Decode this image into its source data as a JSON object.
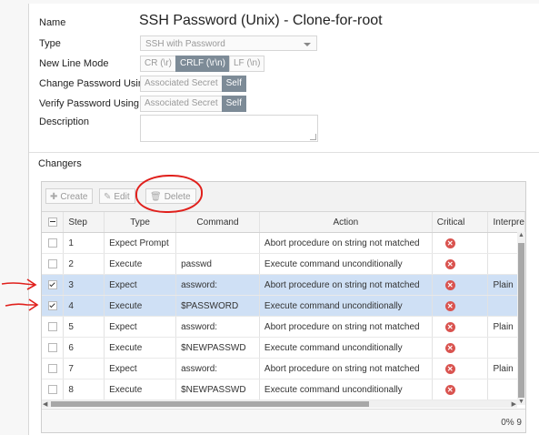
{
  "form": {
    "name_label": "Name",
    "name_value": "SSH Password (Unix) - Clone-for-root",
    "type_label": "Type",
    "type_value": "SSH with Password",
    "newline_label": "New Line Mode",
    "newline_options": [
      "CR (\\r)",
      "CRLF (\\r\\n)",
      "LF (\\n)"
    ],
    "newline_selected": "CRLF (\\r\\n)",
    "change_pw_label": "Change Password Using",
    "verify_pw_label": "Verify Password Using",
    "pw_options": [
      "Associated Secret",
      "Self"
    ],
    "pw_selected": "Self",
    "description_label": "Description",
    "description_value": ""
  },
  "changers": {
    "section_label": "Changers",
    "toolbar": {
      "create": "Create",
      "edit": "Edit",
      "delete": "Delete"
    },
    "columns": [
      "Step",
      "Type",
      "Command",
      "Action",
      "Critical",
      "Interpre"
    ],
    "rows": [
      {
        "step": "1",
        "type": "Expect Prompt",
        "command": "",
        "action": "Abort procedure on string not matched",
        "selected": false,
        "interp": ""
      },
      {
        "step": "2",
        "type": "Execute",
        "command": "passwd",
        "action": "Execute command unconditionally",
        "selected": false,
        "interp": ""
      },
      {
        "step": "3",
        "type": "Expect",
        "command": "assword:",
        "action": "Abort procedure on string not matched",
        "selected": true,
        "interp": "Plain"
      },
      {
        "step": "4",
        "type": "Execute",
        "command": "$PASSWORD",
        "action": "Execute command unconditionally",
        "selected": true,
        "interp": ""
      },
      {
        "step": "5",
        "type": "Expect",
        "command": "assword:",
        "action": "Abort procedure on string not matched",
        "selected": false,
        "interp": "Plain"
      },
      {
        "step": "6",
        "type": "Execute",
        "command": "$NEWPASSWD",
        "action": "Execute command unconditionally",
        "selected": false,
        "interp": ""
      },
      {
        "step": "7",
        "type": "Expect",
        "command": "assword:",
        "action": "Abort procedure on string not matched",
        "selected": false,
        "interp": "Plain"
      },
      {
        "step": "8",
        "type": "Execute",
        "command": "$NEWPASSWD",
        "action": "Execute command unconditionally",
        "selected": false,
        "interp": ""
      }
    ],
    "progress_text": "0% 9"
  },
  "colors": {
    "annotation_red": "#e0201c",
    "selected_row": "#cfe0f5",
    "toggle_on": "#7d8b97",
    "critical_icon": "#d9534f"
  }
}
